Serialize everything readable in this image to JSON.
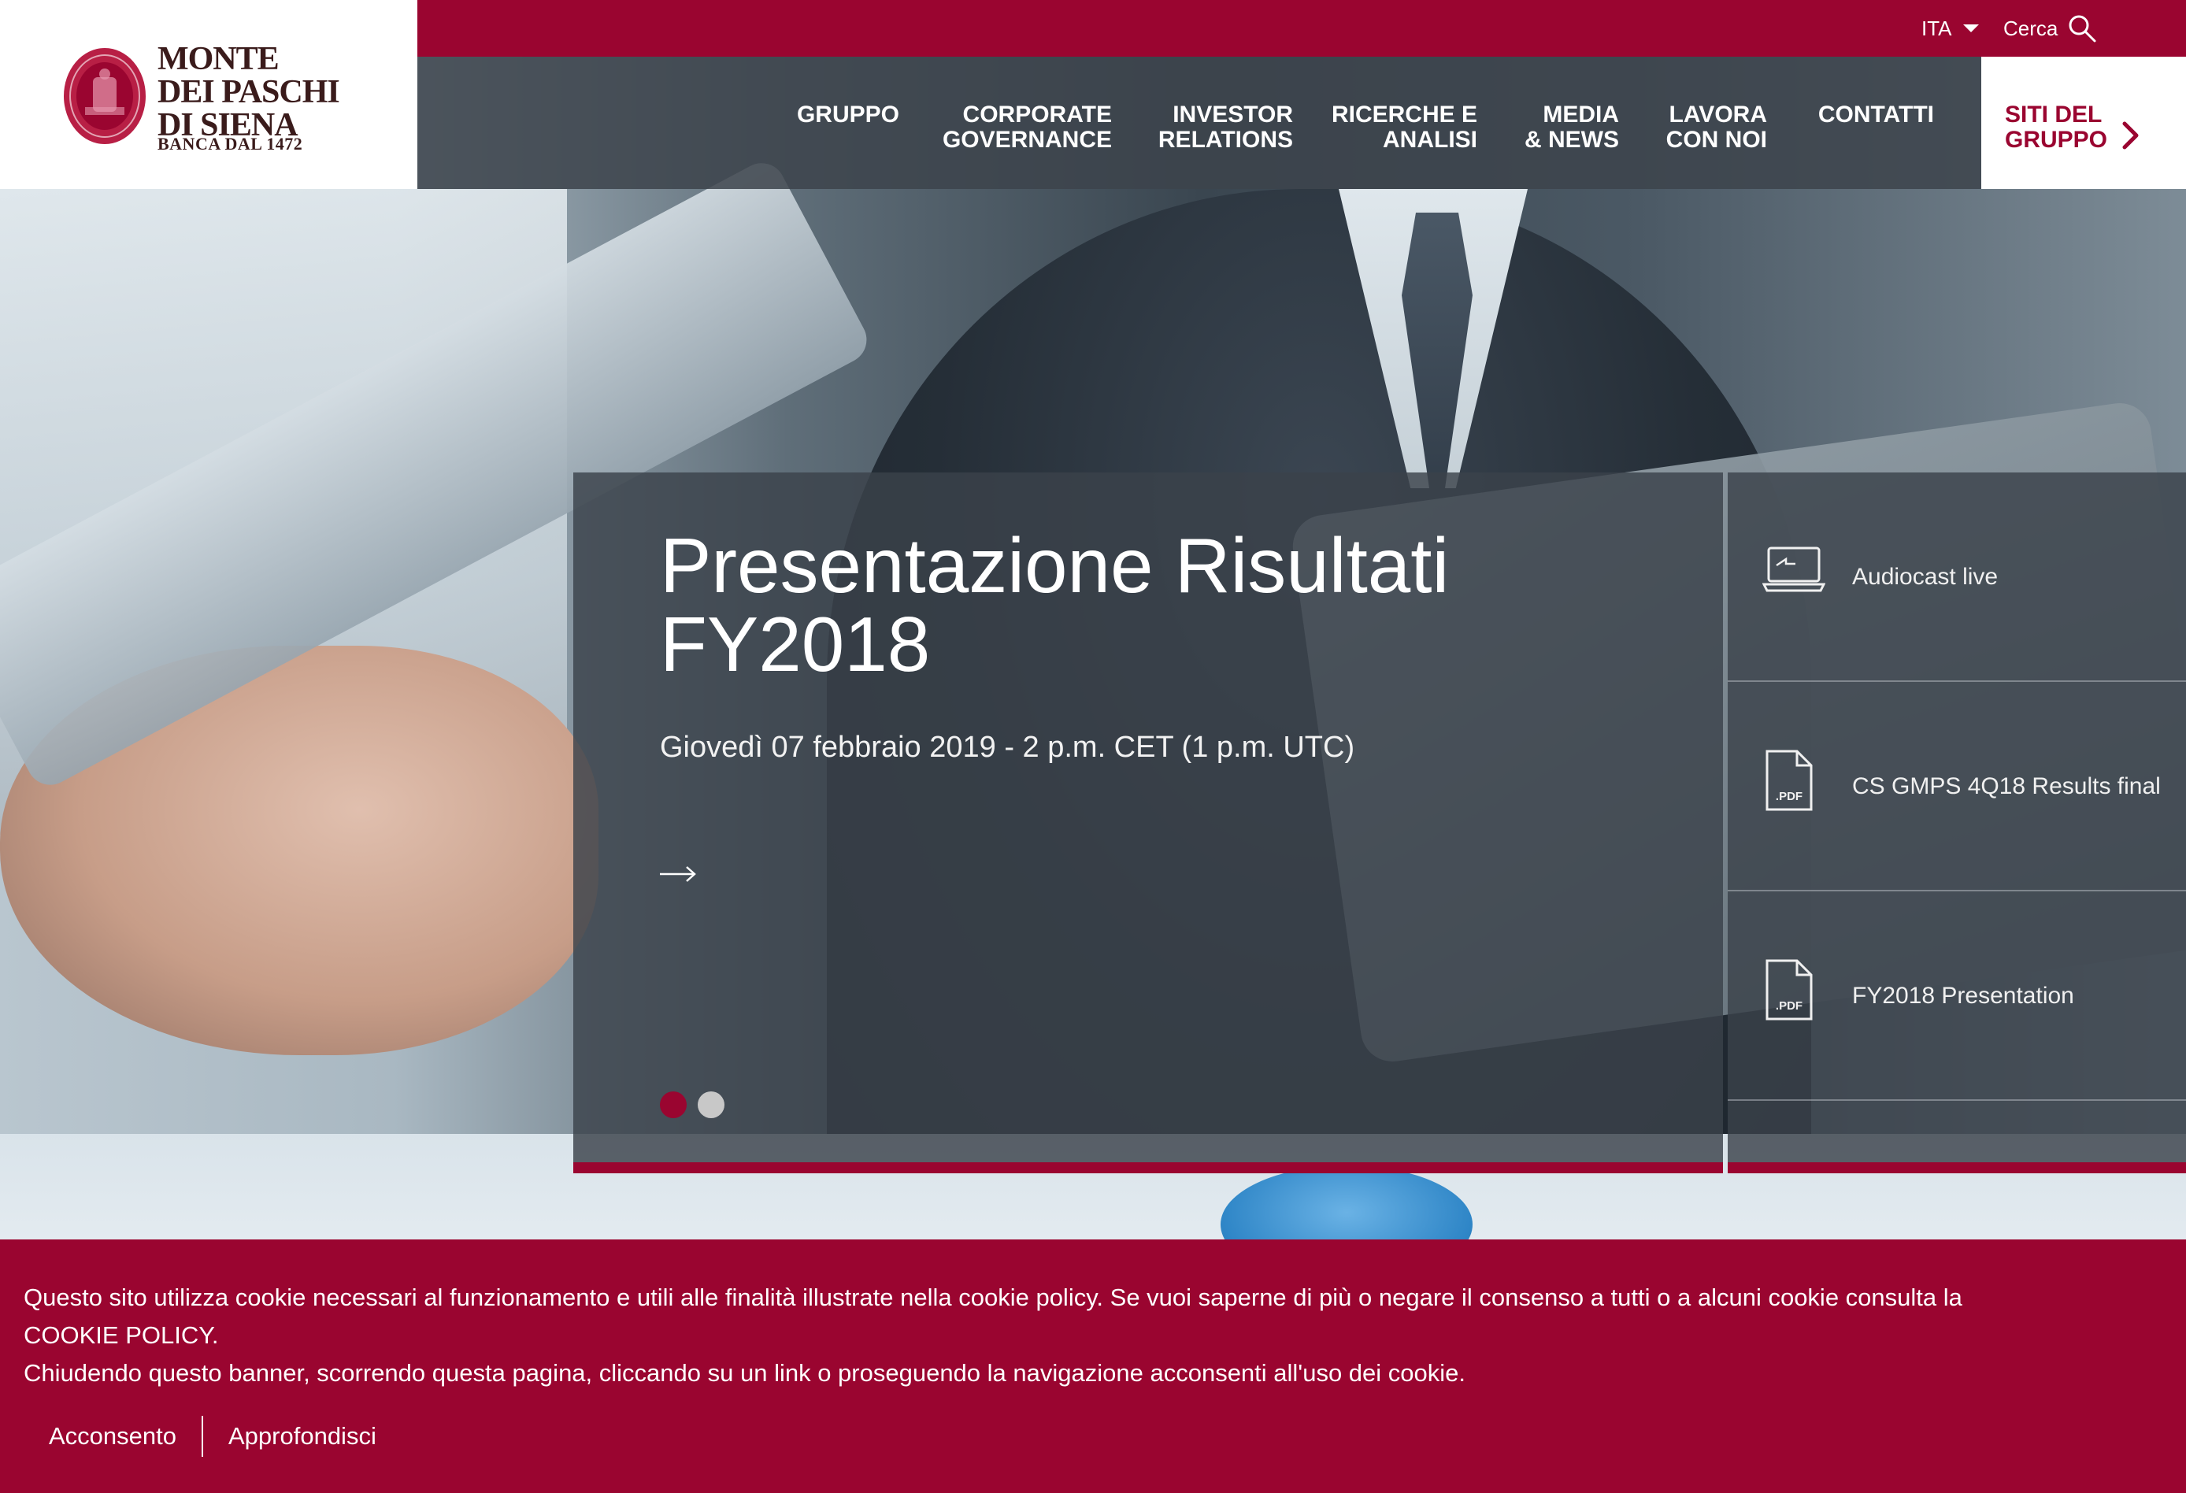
{
  "brand": {
    "logo_lines": [
      "MONTE",
      "DEI PASCHI",
      "DI SIENA"
    ],
    "tagline": "BANCA DAL 1472",
    "colors": {
      "primary": "#9a0530",
      "nav_bg": "#3c444c",
      "white": "#ffffff"
    }
  },
  "topbar": {
    "language": "ITA",
    "search_label": "Cerca"
  },
  "nav": {
    "items": [
      {
        "line1": "",
        "line2": "GRUPPO"
      },
      {
        "line1": "CORPORATE",
        "line2": "GOVERNANCE"
      },
      {
        "line1": "INVESTOR",
        "line2": "RELATIONS"
      },
      {
        "line1": "RICERCHE E",
        "line2": "ANALISI"
      },
      {
        "line1": "MEDIA",
        "line2": "& NEWS"
      },
      {
        "line1": "LAVORA",
        "line2": "CON NOI"
      },
      {
        "line1": "",
        "line2": "CONTATTI"
      }
    ],
    "group_sites": {
      "line1": "SITI DEL",
      "line2": "GRUPPO"
    }
  },
  "hero": {
    "title_line1": "Presentazione Risultati",
    "title_line2": "FY2018",
    "date": "Giovedì 07 febbraio 2019 - 2 p.m. CET (1 p.m. UTC)",
    "slides_total": 2,
    "slide_active": 1
  },
  "side_links": [
    {
      "icon": "laptop-icon",
      "label": "Audiocast live"
    },
    {
      "icon": "pdf-icon",
      "label": "CS GMPS 4Q18 Results final",
      "badge": ".PDF"
    },
    {
      "icon": "pdf-icon",
      "label": "FY2018 Presentation",
      "badge": ".PDF"
    }
  ],
  "cookie": {
    "line1": "Questo sito utilizza cookie necessari al funzionamento e utili alle finalità illustrate nella cookie policy. Se vuoi saperne di più o negare il consenso a tutti o a alcuni cookie consulta la",
    "line2": "COOKIE POLICY.",
    "line3": "Chiudendo questo banner, scorrendo questa pagina, cliccando su un link o proseguendo la navigazione acconsenti all'uso dei cookie.",
    "accept": "Acconsento",
    "more": "Approfondisci"
  }
}
